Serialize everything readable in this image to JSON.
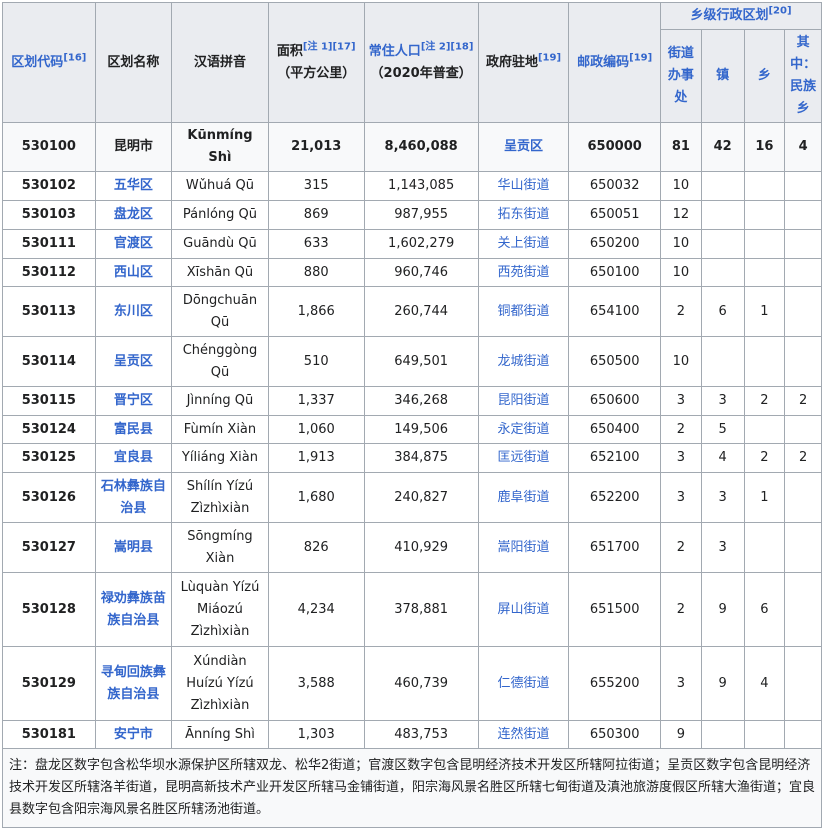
{
  "header": {
    "code": "区划代码",
    "code_ref": "[16]",
    "name": "区划名称",
    "pinyin": "汉语拼音",
    "area": "面积",
    "area_ref": "[注 1][17]",
    "area_unit": "（平方公里）",
    "population": "常住人口",
    "population_ref": "[注 2][18]",
    "population_note": "（2020年普查）",
    "seat": "政府驻地",
    "seat_ref": "[19]",
    "postal": "邮政编码",
    "postal_ref": "[19]",
    "township_group": "乡级行政区划",
    "township_group_ref": "[20]",
    "subdistrict": "街道办事处",
    "town": "镇",
    "township": "乡",
    "ethnic": "其中：民族乡"
  },
  "rows": [
    {
      "code": "530100",
      "name": "昆明市",
      "pinyin": "Kūnmíng Shì",
      "area": "21,013",
      "population": "8,460,088",
      "seat": "呈贡区",
      "postal": "650000",
      "sub": "81",
      "town": "42",
      "twp": "16",
      "eth": "4"
    },
    {
      "code": "530102",
      "name": "五华区",
      "pinyin": "Wǔhuá Qū",
      "area": "315",
      "population": "1,143,085",
      "seat": "华山街道",
      "postal": "650032",
      "sub": "10",
      "town": "",
      "twp": "",
      "eth": ""
    },
    {
      "code": "530103",
      "name": "盘龙区",
      "pinyin": "Pánlóng Qū",
      "area": "869",
      "population": "987,955",
      "seat": "拓东街道",
      "postal": "650051",
      "sub": "12",
      "town": "",
      "twp": "",
      "eth": ""
    },
    {
      "code": "530111",
      "name": "官渡区",
      "pinyin": "Guāndù Qū",
      "area": "633",
      "population": "1,602,279",
      "seat": "关上街道",
      "postal": "650200",
      "sub": "10",
      "town": "",
      "twp": "",
      "eth": ""
    },
    {
      "code": "530112",
      "name": "西山区",
      "pinyin": "Xīshān Qū",
      "area": "880",
      "population": "960,746",
      "seat": "西苑街道",
      "postal": "650100",
      "sub": "10",
      "town": "",
      "twp": "",
      "eth": ""
    },
    {
      "code": "530113",
      "name": "东川区",
      "pinyin": "Dōngchuān Qū",
      "area": "1,866",
      "population": "260,744",
      "seat": "铜都街道",
      "postal": "654100",
      "sub": "2",
      "town": "6",
      "twp": "1",
      "eth": ""
    },
    {
      "code": "530114",
      "name": "呈贡区",
      "pinyin": "Chénggòng Qū",
      "area": "510",
      "population": "649,501",
      "seat": "龙城街道",
      "postal": "650500",
      "sub": "10",
      "town": "",
      "twp": "",
      "eth": ""
    },
    {
      "code": "530115",
      "name": "晋宁区",
      "pinyin": "Jìnníng Qū",
      "area": "1,337",
      "population": "346,268",
      "seat": "昆阳街道",
      "postal": "650600",
      "sub": "3",
      "town": "3",
      "twp": "2",
      "eth": "2"
    },
    {
      "code": "530124",
      "name": "富民县",
      "pinyin": "Fùmín Xiàn",
      "area": "1,060",
      "population": "149,506",
      "seat": "永定街道",
      "postal": "650400",
      "sub": "2",
      "town": "5",
      "twp": "",
      "eth": ""
    },
    {
      "code": "530125",
      "name": "宜良县",
      "pinyin": "Yíliáng Xiàn",
      "area": "1,913",
      "population": "384,875",
      "seat": "匡远街道",
      "postal": "652100",
      "sub": "3",
      "town": "4",
      "twp": "2",
      "eth": "2"
    },
    {
      "code": "530126",
      "name": "石林彝族自治县",
      "pinyin": "Shílín Yízú Zìzhìxiàn",
      "area": "1,680",
      "population": "240,827",
      "seat": "鹿阜街道",
      "postal": "652200",
      "sub": "3",
      "town": "3",
      "twp": "1",
      "eth": ""
    },
    {
      "code": "530127",
      "name": "嵩明县",
      "pinyin": "Sōngmíng Xiàn",
      "area": "826",
      "population": "410,929",
      "seat": "嵩阳街道",
      "postal": "651700",
      "sub": "2",
      "town": "3",
      "twp": "",
      "eth": ""
    },
    {
      "code": "530128",
      "name": "禄劝彝族苗族自治县",
      "pinyin": "Lùquàn Yízú Miáozú Zìzhìxiàn",
      "area": "4,234",
      "population": "378,881",
      "seat": "屏山街道",
      "postal": "651500",
      "sub": "2",
      "town": "9",
      "twp": "6",
      "eth": ""
    },
    {
      "code": "530129",
      "name": "寻甸回族彝族自治县",
      "pinyin": "Xúndiàn Huízú Yízú Zìzhìxiàn",
      "area": "3,588",
      "population": "460,739",
      "seat": "仁德街道",
      "postal": "655200",
      "sub": "3",
      "town": "9",
      "twp": "4",
      "eth": ""
    },
    {
      "code": "530181",
      "name": "安宁市",
      "pinyin": "Ānníng Shì",
      "area": "1,303",
      "population": "483,753",
      "seat": "连然街道",
      "postal": "650300",
      "sub": "9",
      "town": "",
      "twp": "",
      "eth": ""
    }
  ],
  "note": "注：盘龙区数字包含松华坝水源保护区所辖双龙、松华2街道；官渡区数字包含昆明经济技术开发区所辖阿拉街道；呈贡区数字包含昆明经济技术开发区所辖洛羊街道，昆明高新技术产业开发区所辖马金铺街道，阳宗海风景名胜区所辖七甸街道及滇池旅游度假区所辖大渔街道；宜良县数字包含阳宗海风景名胜区所辖汤池街道。"
}
